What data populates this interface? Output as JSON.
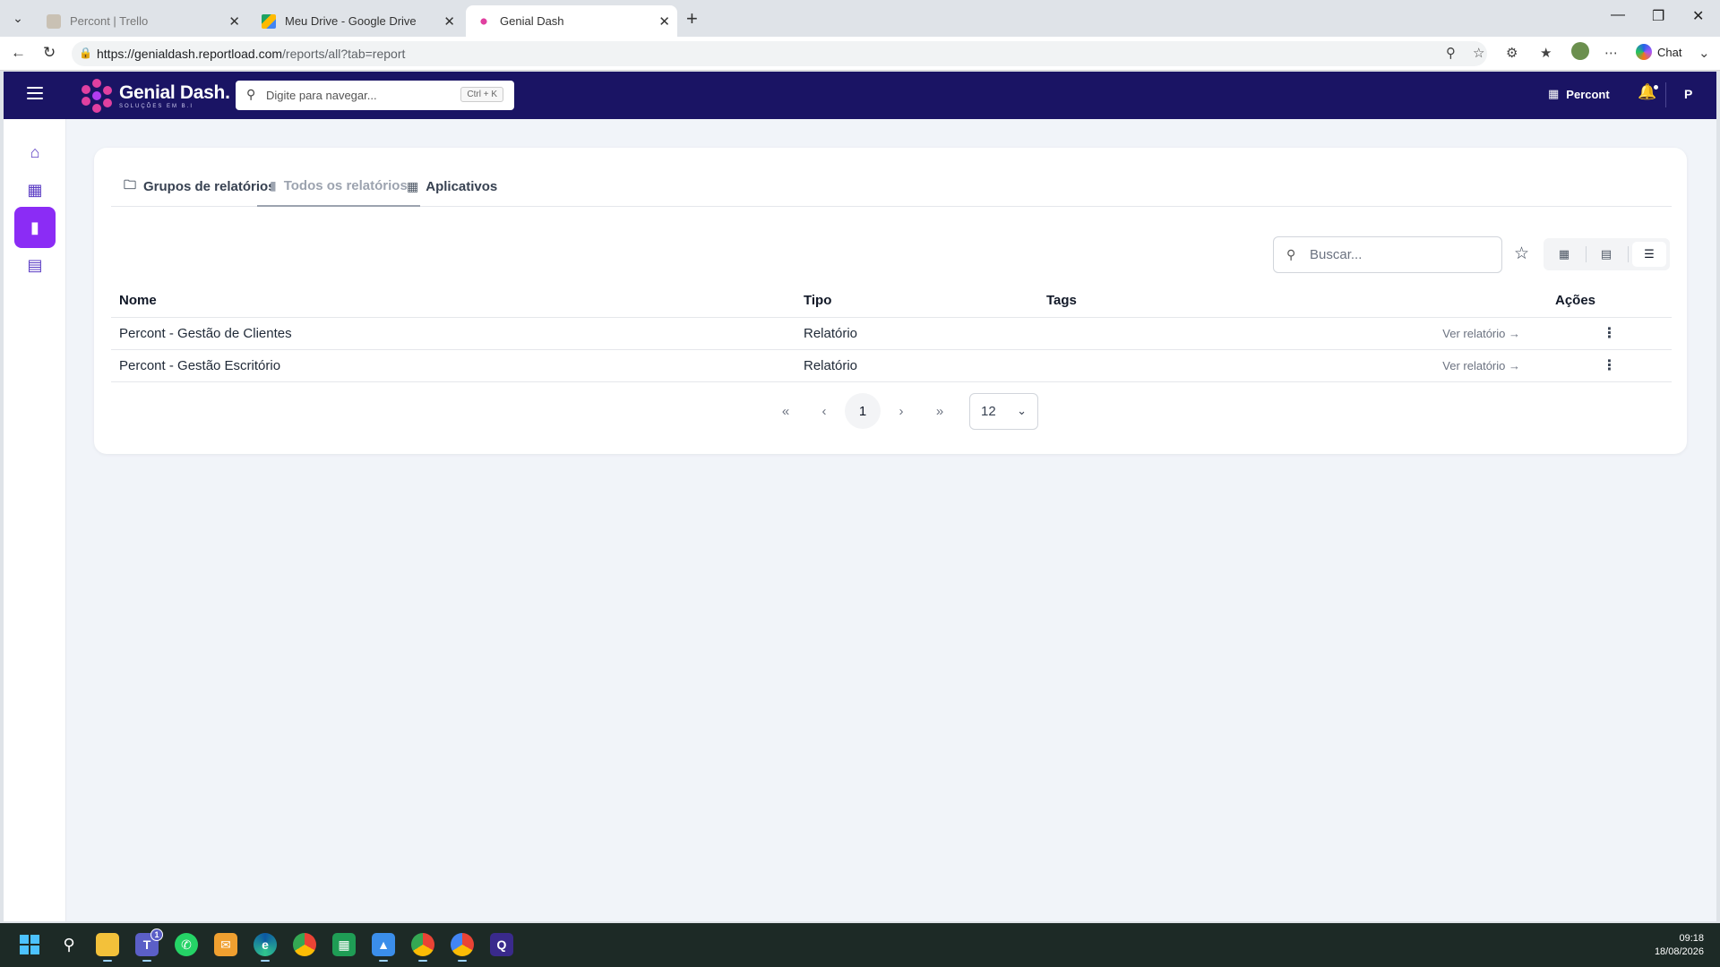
{
  "browser": {
    "tabs": [
      {
        "title": "Percont | Trello",
        "active": false
      },
      {
        "title": "Meu Drive - Google Drive",
        "active": false
      },
      {
        "title": "Genial Dash",
        "active": true
      }
    ],
    "url_host": "https://genialdash.reportload.com",
    "url_path": "/reports/all?tab=report",
    "chat_label": "Chat"
  },
  "app": {
    "logo_name": "Genial Dash.",
    "logo_tagline": "SOLUÇÕES EM B.I",
    "nav_search_placeholder": "Digite para navegar...",
    "nav_search_shortcut": "Ctrl + K",
    "org_name": "Percont",
    "user_initial": "P",
    "sidebar": [
      {
        "icon": "home-icon",
        "active": false
      },
      {
        "icon": "dashboard-icon",
        "active": false
      },
      {
        "icon": "bar-chart-icon",
        "active": true
      },
      {
        "icon": "monitor-chart-icon",
        "active": false
      }
    ],
    "accent_color": "#8b2cf5",
    "nav_color": "#1a1464"
  },
  "main": {
    "tabs": [
      {
        "label": "Grupos de relatórios",
        "icon": "folder-icon",
        "active": false
      },
      {
        "label": "Todos os relatórios",
        "icon": "bar-chart-icon",
        "active": true
      },
      {
        "label": "Aplicativos",
        "icon": "grid-icon",
        "active": false
      }
    ],
    "search_placeholder": "Buscar...",
    "table": {
      "headers": [
        "Nome",
        "Tipo",
        "Tags",
        "Ações"
      ],
      "rows": [
        {
          "nome": "Percont - Gestão de Clientes",
          "tipo": "Relatório",
          "tags": "",
          "action": "Ver relatório"
        },
        {
          "nome": "Percont - Gestão Escritório",
          "tipo": "Relatório",
          "tags": "",
          "action": "Ver relatório"
        }
      ]
    },
    "pagination": {
      "current_page": "1",
      "page_size": "12"
    }
  },
  "taskbar": {
    "time": "09:18",
    "date": "18/08/2026",
    "teams_badge": "1"
  }
}
